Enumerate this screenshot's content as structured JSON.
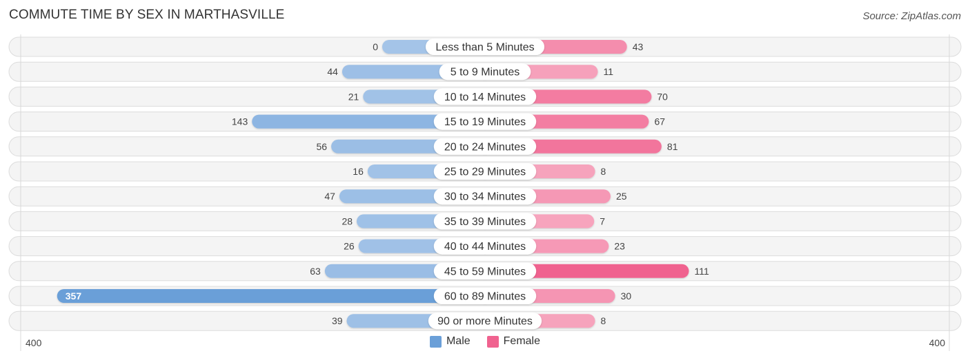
{
  "header": {
    "title": "COMMUTE TIME BY SEX IN MARTHASVILLE",
    "source": "Source: ZipAtlas.com"
  },
  "legend": {
    "male_label": "Male",
    "female_label": "Female"
  },
  "colors": {
    "male": "#6a9fd8",
    "male_light": "#a4c4e8",
    "female": "#f0628f",
    "female_light": "#f7a8c0",
    "row_background": "#f4f4f4"
  },
  "chart_data": {
    "type": "bar",
    "orientation": "horizontal-diverging",
    "title": "COMMUTE TIME BY SEX IN MARTHASVILLE",
    "xlabel": "",
    "ylabel": "",
    "axis_min_label": "400",
    "axis_max_label": "400",
    "xlim": [
      -400,
      400
    ],
    "legend_position": "bottom-center",
    "categories": [
      "Less than 5 Minutes",
      "5 to 9 Minutes",
      "10 to 14 Minutes",
      "15 to 19 Minutes",
      "20 to 24 Minutes",
      "25 to 29 Minutes",
      "30 to 34 Minutes",
      "35 to 39 Minutes",
      "40 to 44 Minutes",
      "45 to 59 Minutes",
      "60 to 89 Minutes",
      "90 or more Minutes"
    ],
    "series": [
      {
        "name": "Male",
        "side": "left",
        "values": [
          0,
          44,
          21,
          143,
          56,
          16,
          47,
          28,
          26,
          63,
          357,
          39
        ]
      },
      {
        "name": "Female",
        "side": "right",
        "values": [
          43,
          11,
          70,
          67,
          81,
          8,
          25,
          7,
          23,
          111,
          30,
          8
        ]
      }
    ]
  }
}
